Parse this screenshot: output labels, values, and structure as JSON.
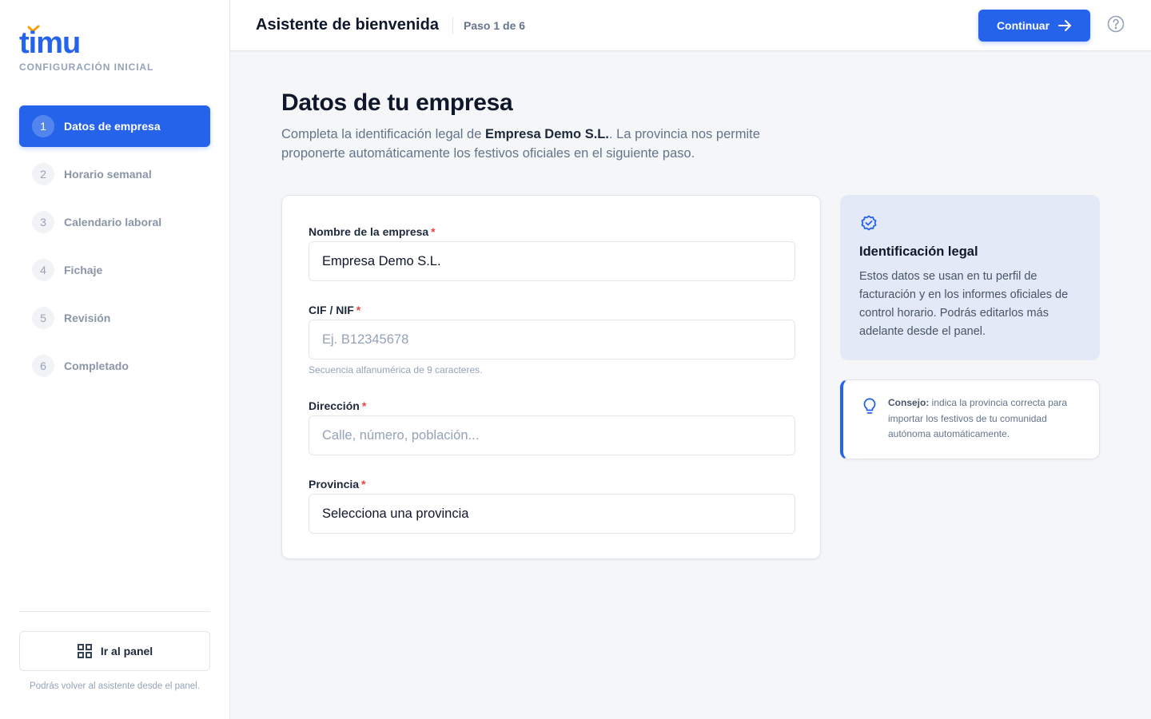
{
  "brand": {
    "logo_text": "timu",
    "subtitle": "CONFIGURACIÓN INICIAL",
    "accent": "#2563eb",
    "logo_mark_color": "#f59e0b"
  },
  "sidebar": {
    "steps": [
      {
        "num": "1",
        "label": "Datos de empresa",
        "active": true
      },
      {
        "num": "2",
        "label": "Horario semanal",
        "active": false
      },
      {
        "num": "3",
        "label": "Calendario laboral",
        "active": false
      },
      {
        "num": "4",
        "label": "Fichaje",
        "active": false
      },
      {
        "num": "5",
        "label": "Revisión",
        "active": false
      },
      {
        "num": "6",
        "label": "Completado",
        "active": false
      }
    ],
    "panel_button": "Ir al panel",
    "note": "Podrás volver al asistente desde el panel."
  },
  "topbar": {
    "title": "Asistente de bienvenida",
    "step_indicator": "Paso 1 de 6",
    "continue_label": "Continuar"
  },
  "main": {
    "title": "Datos de tu empresa",
    "desc_prefix": "Completa la identificación legal de ",
    "company_name": "Empresa Demo S.L.",
    "desc_suffix": ". La provincia nos permite proponerte automáticamente los festivos oficiales en el siguiente paso."
  },
  "form": {
    "company": {
      "label": "Nombre de la empresa",
      "value": "Empresa Demo S.L."
    },
    "cif": {
      "label": "CIF / NIF",
      "placeholder": "Ej. B12345678",
      "hint": "Secuencia alfanumérica de 9 caracteres."
    },
    "address": {
      "label": "Dirección",
      "placeholder": "Calle, número, población..."
    },
    "province": {
      "label": "Provincia",
      "value": "Selecciona una provincia"
    },
    "required_mark": "*"
  },
  "info": {
    "title": "Identificación legal",
    "text": "Estos datos se usan en tu perfil de facturación y en los informes oficiales de control horario. Podrás editarlos más adelante desde el panel."
  },
  "tip": {
    "label": "Consejo:",
    "text": " indica la provincia correcta para importar los festivos de tu comunidad autónoma automáticamente."
  }
}
